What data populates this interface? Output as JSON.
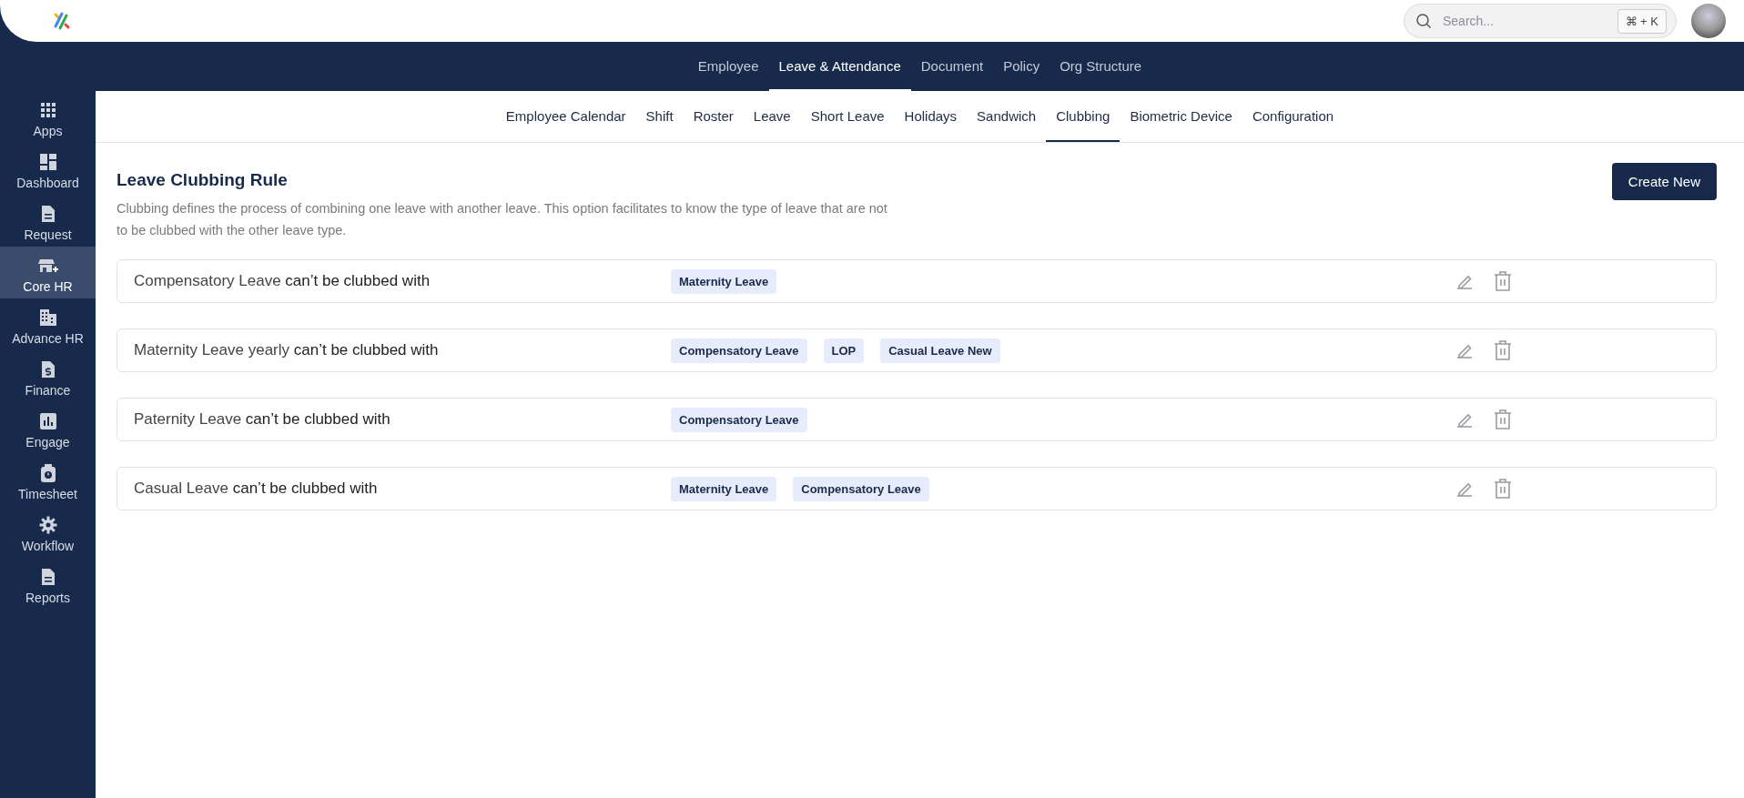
{
  "header": {
    "search": {
      "placeholder": "Search...",
      "shortcut": "⌘ + K"
    }
  },
  "main_tabs": [
    {
      "label": "Employee",
      "selected": false
    },
    {
      "label": "Leave & Attendance",
      "selected": true
    },
    {
      "label": "Document",
      "selected": false
    },
    {
      "label": "Policy",
      "selected": false
    },
    {
      "label": "Org Structure",
      "selected": false
    }
  ],
  "sidebar": {
    "items": [
      {
        "label": "Apps",
        "kind": "apps",
        "selected": false
      },
      {
        "label": "Dashboard",
        "kind": "dashboard",
        "selected": false
      },
      {
        "label": "Request",
        "kind": "document",
        "selected": false
      },
      {
        "label": "Core HR",
        "kind": "store",
        "selected": true
      },
      {
        "label": "Advance HR",
        "kind": "building",
        "selected": false
      },
      {
        "label": "Finance",
        "kind": "money",
        "selected": false
      },
      {
        "label": "Engage",
        "kind": "chart",
        "selected": false
      },
      {
        "label": "Timesheet",
        "kind": "timer",
        "selected": false
      },
      {
        "label": "Workflow",
        "kind": "gear",
        "selected": false
      },
      {
        "label": "Reports",
        "kind": "document",
        "selected": false
      }
    ]
  },
  "sub_tabs": [
    {
      "label": "Employee Calendar",
      "selected": false
    },
    {
      "label": "Shift",
      "selected": false
    },
    {
      "label": "Roster",
      "selected": false
    },
    {
      "label": "Leave",
      "selected": false
    },
    {
      "label": "Short Leave",
      "selected": false
    },
    {
      "label": "Holidays",
      "selected": false
    },
    {
      "label": "Sandwich",
      "selected": false
    },
    {
      "label": "Clubbing",
      "selected": true
    },
    {
      "label": "Biometric Device",
      "selected": false
    },
    {
      "label": "Configuration",
      "selected": false
    }
  ],
  "page": {
    "title": "Leave Clubbing Rule",
    "description": "Clubbing defines the process of combining one leave with another leave. This option facilitates to know the type of leave that are not to be clubbed with the other leave type.",
    "create_button": "Create New"
  },
  "rules": [
    {
      "leave": "Compensatory Leave",
      "suffix": "can’t be clubbed with",
      "tags": [
        "Maternity Leave"
      ]
    },
    {
      "leave": "Maternity Leave yearly",
      "suffix": "can’t be clubbed with",
      "tags": [
        "Compensatory Leave",
        "LOP",
        "Casual Leave New"
      ]
    },
    {
      "leave": "Paternity Leave",
      "suffix": "can’t be clubbed with",
      "tags": [
        "Compensatory Leave"
      ]
    },
    {
      "leave": "Casual Leave",
      "suffix": "can’t be clubbed with",
      "tags": [
        "Maternity Leave",
        "Compensatory Leave"
      ]
    }
  ]
}
